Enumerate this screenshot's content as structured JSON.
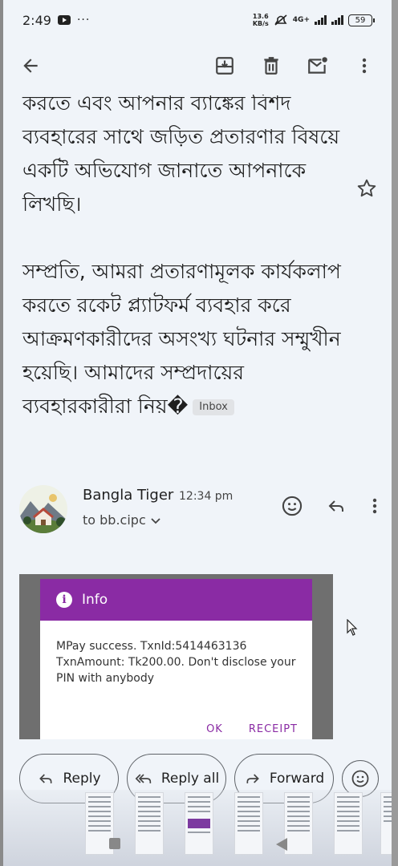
{
  "status_bar": {
    "time": "2:49",
    "more": "···",
    "net_speed_value": "13.6",
    "net_speed_unit": "KB/s",
    "network_type": "4G+",
    "battery": "59"
  },
  "email": {
    "body_part1": "করতে এবং আপনার ব্যাঙ্কের বিশদ ব্যবহারের সাথে জড়িত প্রতারণার বিষয়ে একটি অভিযোগ জানাতে আপনাকে লিখছি।",
    "body_part2": "সম্প্রতি, আমরা প্রতারণামূলক কার্যকলাপ করতে রকেট প্ল্যাটফর্ম ব্যবহার করে আক্রমণকারীদের অসংখ্য ঘটনার সম্মুখীন হয়েছি। আমাদের সম্প্রদায়ের ব্যবহারকারীরা নিয়�",
    "label_chip": "Inbox",
    "sender_name": "Bangla Tiger",
    "time": "12:34 pm",
    "to": "to bb.cipc"
  },
  "attachment": {
    "dialog_title": "Info",
    "message": "MPay success. TxnId:5414463136 TxnAmount: Tk200.00. Don't disclose your PIN with anybody",
    "ok_label": "OK",
    "receipt_label": "RECEIPT"
  },
  "actions": {
    "reply": "Reply",
    "reply_all": "Reply all",
    "forward": "Forward"
  },
  "colors": {
    "background": "#f0f4f9",
    "dialog_header": "#8a2ba4",
    "text": "#1f1f1f"
  },
  "icons": [
    "back-arrow-icon",
    "archive-icon",
    "delete-icon",
    "mark-unread-icon",
    "more-vert-icon",
    "star-icon",
    "emoji-icon",
    "reply-icon",
    "reply-all-icon",
    "forward-icon",
    "info-icon",
    "chevron-down-icon"
  ]
}
